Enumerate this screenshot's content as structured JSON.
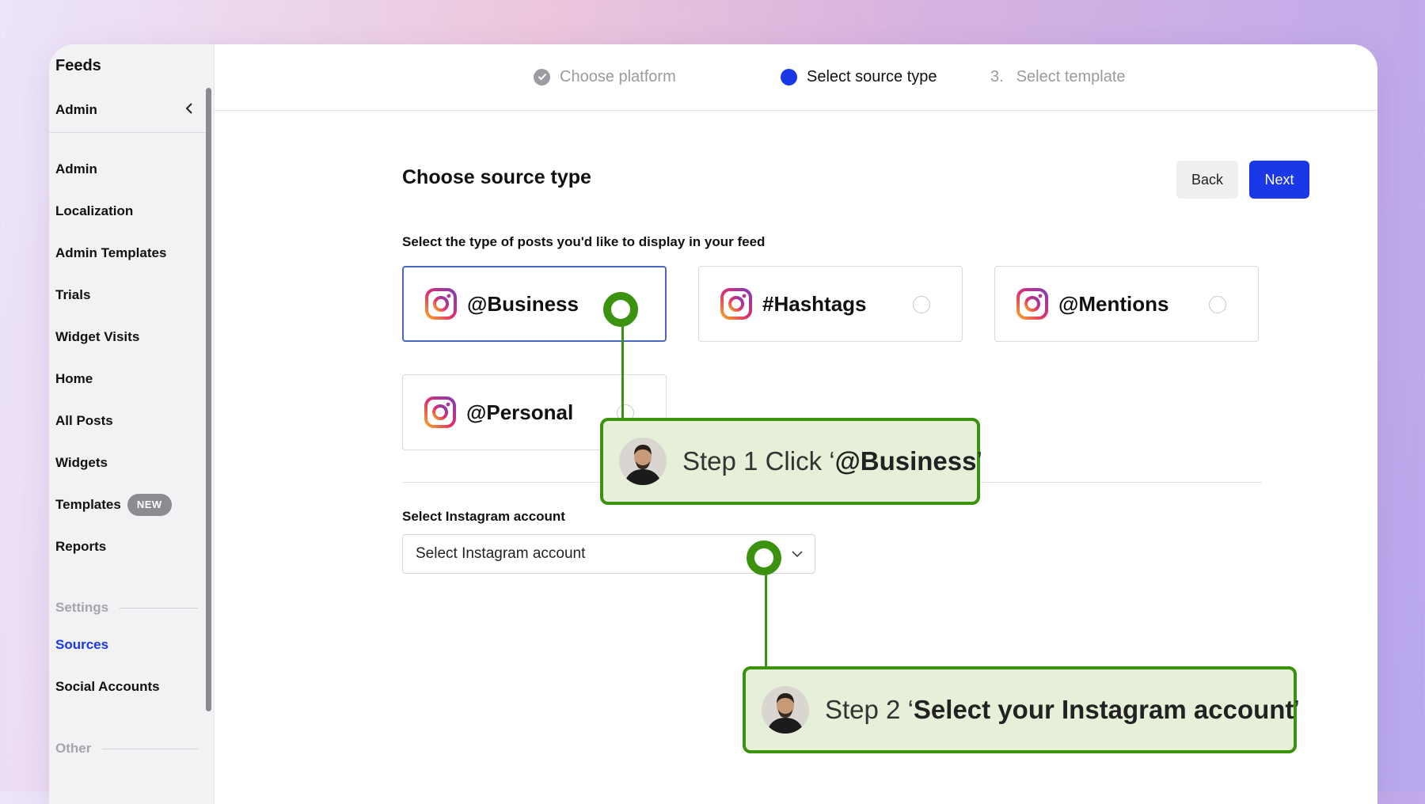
{
  "sidebar": {
    "brand": "Feeds",
    "workspace": "Admin",
    "items": [
      {
        "label": "Admin"
      },
      {
        "label": "Localization"
      },
      {
        "label": "Admin Templates"
      },
      {
        "label": "Trials"
      },
      {
        "label": "Widget Visits"
      },
      {
        "label": "Home"
      },
      {
        "label": "All Posts"
      },
      {
        "label": "Widgets"
      },
      {
        "label": "Templates",
        "badge": "NEW"
      },
      {
        "label": "Reports"
      }
    ],
    "settings_heading": "Settings",
    "settings_items": [
      {
        "label": "Sources",
        "active": true
      },
      {
        "label": "Social Accounts"
      }
    ],
    "other_heading": "Other"
  },
  "stepper": {
    "steps": [
      {
        "label": "Choose platform",
        "state": "done"
      },
      {
        "label": "Select source type",
        "state": "current"
      },
      {
        "number": "3.",
        "label": "Select template",
        "state": "upcoming"
      }
    ]
  },
  "main": {
    "title": "Choose source type",
    "back_label": "Back",
    "next_label": "Next",
    "subtitle": "Select the type of posts you'd like to display in your feed",
    "source_types": [
      {
        "label": "@Business",
        "icon": "instagram-icon",
        "selected": true
      },
      {
        "label": "#Hashtags",
        "icon": "instagram-icon",
        "selected": false
      },
      {
        "label": "@Mentions",
        "icon": "instagram-icon",
        "selected": false
      },
      {
        "label": "@Personal",
        "icon": "instagram-icon",
        "selected": false
      }
    ],
    "account_label": "Select Instagram account",
    "account_placeholder": "Select Instagram account"
  },
  "annotations": {
    "step1": {
      "prefix": "Step 1 Click ‘",
      "bold": "@Business",
      "suffix": "’"
    },
    "step2": {
      "prefix": "Step 2  ‘",
      "bold": "Select your Instagram account",
      "suffix": "’"
    }
  },
  "colors": {
    "accent": "#1a37e8",
    "annotation_green": "#3a920e",
    "annotation_fill": "#e6f0d8"
  }
}
